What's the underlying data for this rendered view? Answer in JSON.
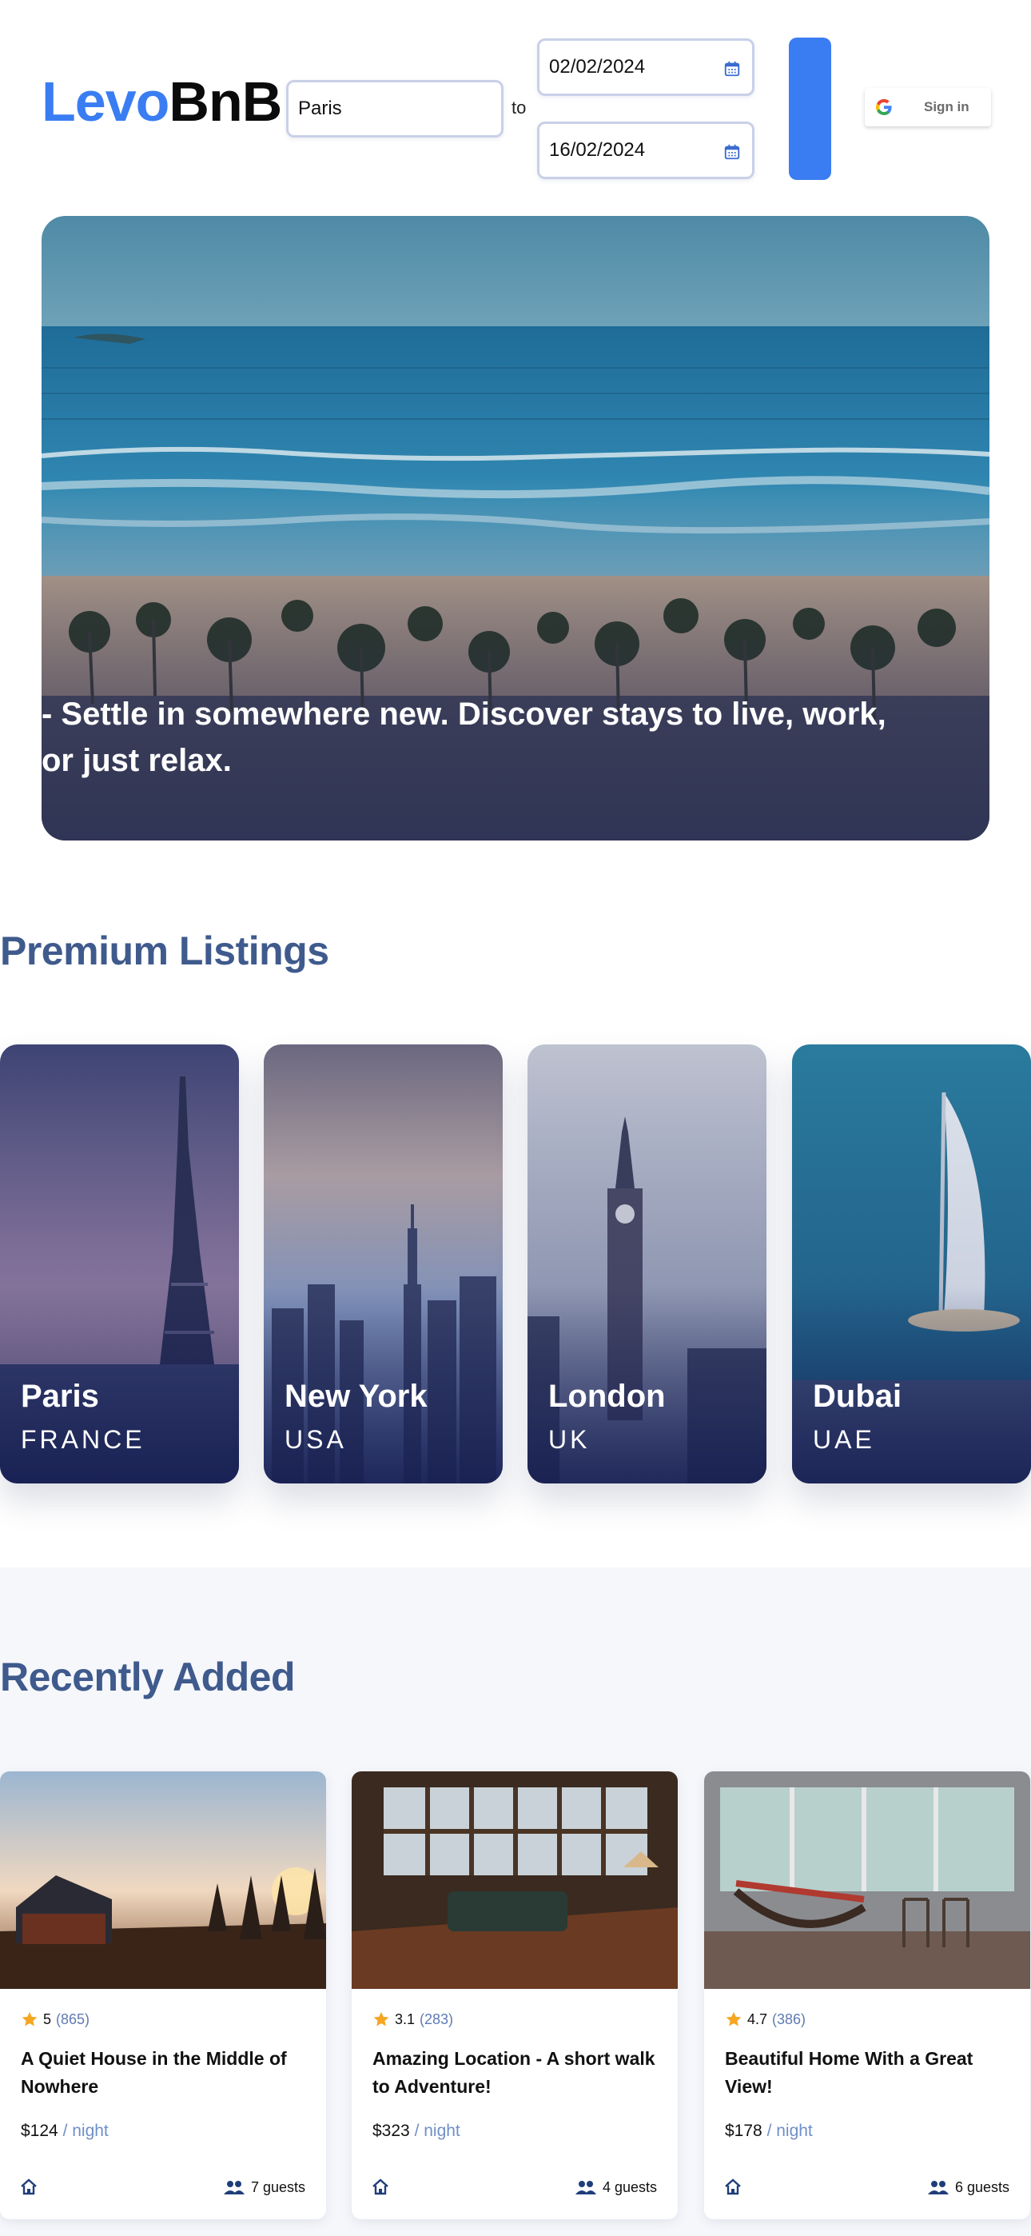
{
  "header": {
    "logo_part1": "Levo",
    "logo_part2": "BnB",
    "city_value": "Paris",
    "to_label": "to",
    "check_in": "02/02/2024",
    "check_out": "16/02/2024",
    "signin_label": "Sign in"
  },
  "hero": {
    "caption": "- Settle in somewhere new. Discover stays to live, work, or just relax."
  },
  "premium": {
    "title": "Premium Listings",
    "cards": [
      {
        "city": "Paris",
        "country": "FRANCE"
      },
      {
        "city": "New York",
        "country": "USA"
      },
      {
        "city": "London",
        "country": "UK"
      },
      {
        "city": "Dubai",
        "country": "UAE"
      }
    ]
  },
  "recent": {
    "title": "Recently Added",
    "listings": [
      {
        "rating": "5",
        "reviews": "(865)",
        "title": "A Quiet House in the Middle of Nowhere",
        "price": "$124",
        "price_unit": "/ night",
        "guests": "7 guests"
      },
      {
        "rating": "3.1",
        "reviews": "(283)",
        "title": "Amazing Location - A short walk to Adventure!",
        "price": "$323",
        "price_unit": "/ night",
        "guests": "4 guests"
      },
      {
        "rating": "4.7",
        "reviews": "(386)",
        "title": "Beautiful Home With a Great View!",
        "price": "$178",
        "price_unit": "/ night",
        "guests": "6 guests"
      }
    ]
  },
  "colors": {
    "brand_blue": "#3a7df2",
    "section_title": "#3f5a8c",
    "star": "#f5a623"
  },
  "icons": [
    "calendar-icon",
    "google-icon",
    "star-icon",
    "home-icon",
    "guests-icon"
  ]
}
